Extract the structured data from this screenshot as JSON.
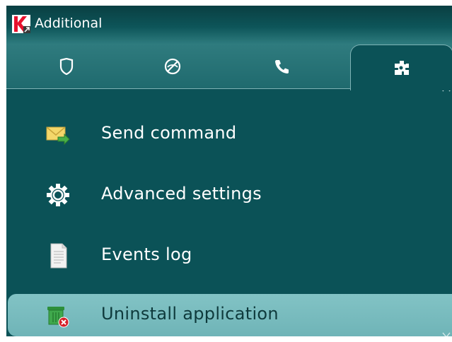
{
  "window": {
    "title": "Additional"
  },
  "tabs": [
    {
      "id": "protection",
      "icon": "shield-icon",
      "active": false
    },
    {
      "id": "antitheft",
      "icon": "no-eye-icon",
      "active": false
    },
    {
      "id": "calls",
      "icon": "phone-icon",
      "active": false
    },
    {
      "id": "additional",
      "icon": "puzzle-gear-icon",
      "active": true
    }
  ],
  "menu": {
    "items": [
      {
        "label": "Send command",
        "icon": "envelope-send-icon"
      },
      {
        "label": "Advanced settings",
        "icon": "gear-icon"
      },
      {
        "label": "Events log",
        "icon": "document-icon"
      },
      {
        "label": "Uninstall application",
        "icon": "uninstall-bin-icon",
        "selected": true
      }
    ]
  },
  "colors": {
    "background": "#0b5257",
    "tabbar": "#2f7b7e",
    "selected": "#7bbcbe",
    "logo_red": "#e8112d"
  }
}
